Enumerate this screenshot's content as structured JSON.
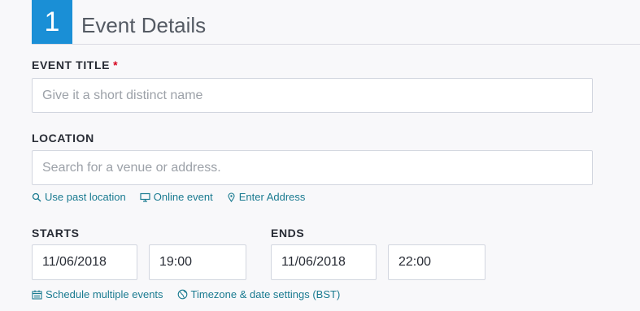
{
  "section": {
    "step_number": "1",
    "title": "Event Details"
  },
  "event_title": {
    "label": "EVENT TITLE",
    "required_mark": "*",
    "placeholder": "Give it a short distinct name",
    "value": ""
  },
  "location": {
    "label": "LOCATION",
    "placeholder": "Search for a venue or address.",
    "value": "",
    "links": [
      {
        "label": "Use past location",
        "icon": "search-icon"
      },
      {
        "label": "Online event",
        "icon": "monitor-icon"
      },
      {
        "label": "Enter Address",
        "icon": "map-pin-icon"
      }
    ]
  },
  "starts": {
    "label": "STARTS",
    "date": "11/06/2018",
    "time": "19:00"
  },
  "ends": {
    "label": "ENDS",
    "date": "11/06/2018",
    "time": "22:00"
  },
  "schedule_links": [
    {
      "label": "Schedule multiple events",
      "icon": "calendar-icon"
    },
    {
      "label": "Timezone & date settings (BST)",
      "icon": "globe-icon"
    }
  ],
  "colors": {
    "accent": "#1a8fd6",
    "link": "#197a90",
    "required": "#d6001c"
  }
}
